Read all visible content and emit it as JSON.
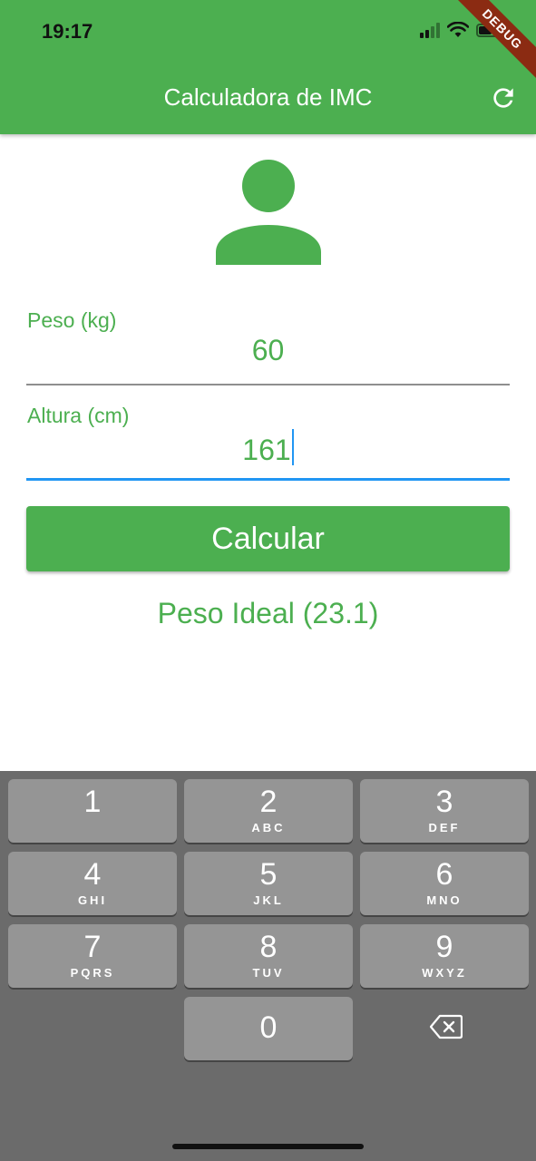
{
  "status": {
    "time": "19:17"
  },
  "appbar": {
    "title": "Calculadora de IMC",
    "refresh_icon": "refresh-icon",
    "debug_label": "DEBUG"
  },
  "colors": {
    "primary": "#4CAF50",
    "focus": "#2196F3",
    "keyboard_bg": "#6b6b6b",
    "key_bg": "#959595"
  },
  "form": {
    "weight": {
      "label": "Peso (kg)",
      "value": "60"
    },
    "height": {
      "label": "Altura (cm)",
      "value": "161"
    },
    "calculate_label": "Calcular",
    "result": "Peso Ideal (23.1)"
  },
  "keyboard": {
    "keys": [
      {
        "num": "1",
        "letters": ""
      },
      {
        "num": "2",
        "letters": "ABC"
      },
      {
        "num": "3",
        "letters": "DEF"
      },
      {
        "num": "4",
        "letters": "GHI"
      },
      {
        "num": "5",
        "letters": "JKL"
      },
      {
        "num": "6",
        "letters": "MNO"
      },
      {
        "num": "7",
        "letters": "PQRS"
      },
      {
        "num": "8",
        "letters": "TUV"
      },
      {
        "num": "9",
        "letters": "WXYZ"
      },
      {
        "num": "0",
        "letters": ""
      }
    ],
    "delete_icon": "backspace-icon"
  }
}
